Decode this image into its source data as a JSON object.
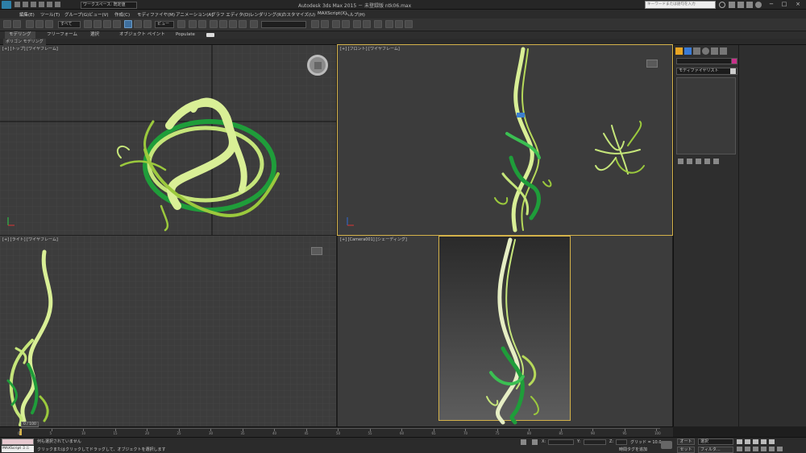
{
  "window": {
    "title": "Autodesk 3ds Max  2015  － 未登録版     ntk06.max",
    "workspace_label": "ワークスペース: 既定値",
    "search_placeholder": "キーワードまたは語句を入力"
  },
  "menu": {
    "items": [
      "編集(E)",
      "ツール(T)",
      "グループ(G)",
      "ビュー(V)",
      "作成(C)",
      "モディファイヤ(M)",
      "アニメーション(A)",
      "グラフ エディタ(D)",
      "レンダリング(R)",
      "カスタマイズ(U)",
      "MAXScript(X)",
      "ヘルプ(H)"
    ]
  },
  "toolbar": {
    "selection_filter": "すべて",
    "view_label": "ビュー"
  },
  "ribbon": {
    "tabs": [
      "モデリング",
      "フリーフォーム",
      "選択",
      "オブジェクト ペイント",
      "Populate"
    ],
    "sub_label": "ポリゴン モデリング"
  },
  "viewports": {
    "top": "[+] [トップ] [ワイヤフレーム]",
    "front": "[+] [フロント] [ワイヤフレーム]",
    "left": "[+] [ライト] [ワイヤフレーム]",
    "camera": "[+] [Camera001] [シェーディング]"
  },
  "command_panel": {
    "modifier_list": "モディファイヤリスト",
    "accent_color": "#c8308a"
  },
  "timeline": {
    "frame_counter": "0 / 100",
    "ticks": [
      "0",
      "5",
      "10",
      "15",
      "20",
      "25",
      "30",
      "35",
      "40",
      "45",
      "50",
      "55",
      "60",
      "65",
      "70",
      "75",
      "80",
      "85",
      "90",
      "95",
      "100"
    ]
  },
  "status": {
    "maxscript": "MAXScript ミニ",
    "line1": "何も選択されていません",
    "line2": "クリックまたはクリックしてドラッグして、オブジェクトを選択します",
    "x_label": "X:",
    "y_label": "Y:",
    "z_label": "Z:",
    "grid": "グリッド = 10.0",
    "add_time_tag": "時間タグを追加",
    "auto_key": "オート",
    "set_key": "セット",
    "selection": "選択",
    "filters": "フィルタ..."
  }
}
